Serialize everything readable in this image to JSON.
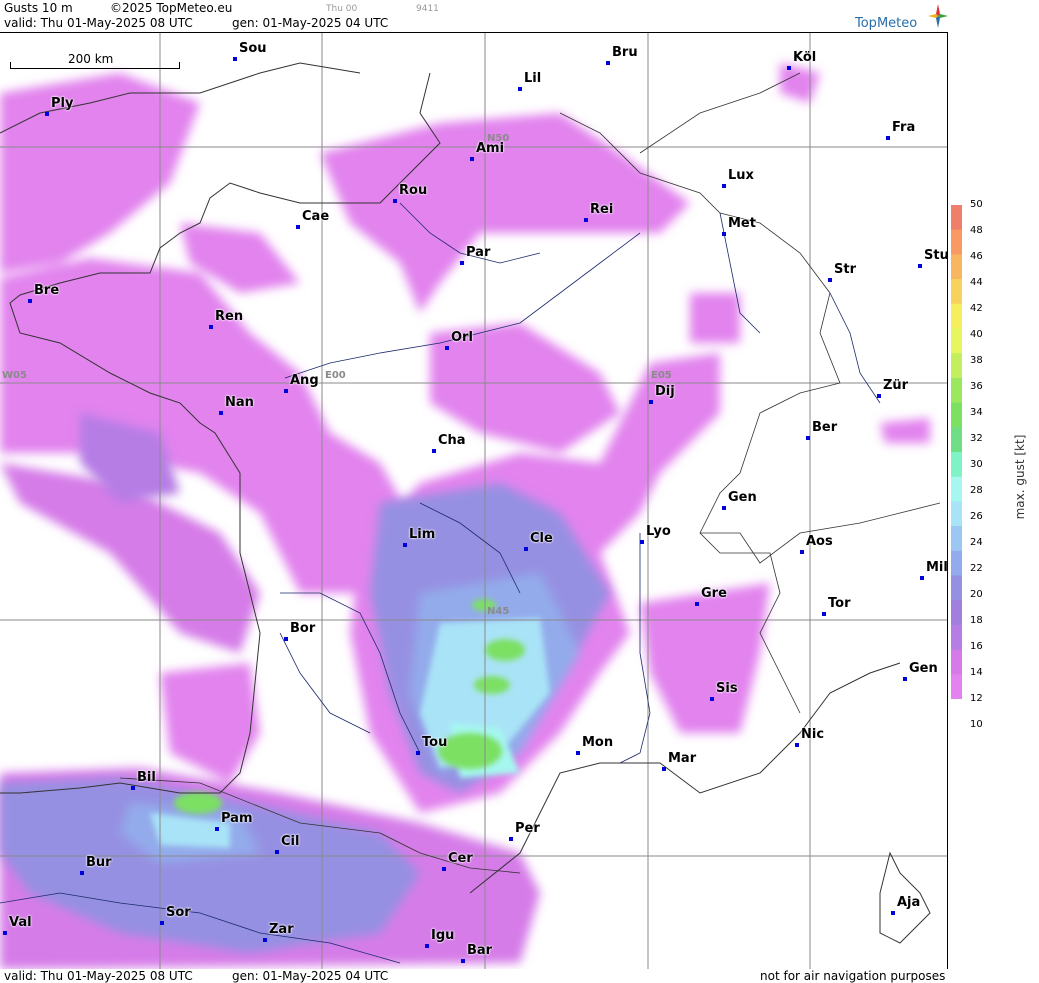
{
  "header": {
    "product": "Gusts 10 m",
    "copyright": "©2025 TopMeteo.eu",
    "run_small": "Thu 00",
    "code_small": "9411",
    "valid": "valid:  Thu  01-May-2025  08 UTC",
    "gen": "gen: 01-May-2025 04 UTC",
    "logo": "TopMeteo"
  },
  "footer": {
    "valid": "valid:  Thu  01-May-2025  08 UTC",
    "gen": "gen: 01-May-2025 04 UTC",
    "disclaimer": "not for air navigation purposes"
  },
  "scale_label": "200 km",
  "grid_labels": [
    "N50",
    "N45",
    "W05",
    "E00",
    "E05"
  ],
  "cities": [
    "Sou",
    "Bru",
    "Köl",
    "Ply",
    "Lil",
    "Fra",
    "Ami",
    "Lux",
    "Rou",
    "Rei",
    "Cae",
    "Met",
    "Par",
    "Stu",
    "Bre",
    "Str",
    "Ren",
    "Orl",
    "Ang",
    "Dij",
    "Zür",
    "Nan",
    "Ber",
    "Cha",
    "Gen",
    "Lim",
    "Cle",
    "Lyo",
    "Aos",
    "Mil",
    "Gre",
    "Tor",
    "Bor",
    "Sis",
    "Gen",
    "Tou",
    "Mon",
    "Nic",
    "Mar",
    "Bil",
    "Pam",
    "Per",
    "Cil",
    "Cer",
    "Bur",
    "Aja",
    "Sor",
    "Val",
    "Zar",
    "Igu",
    "Bar"
  ],
  "legend": {
    "title": "max. gust [kt]",
    "ticks": [
      "50",
      "48",
      "46",
      "44",
      "42",
      "40",
      "38",
      "36",
      "34",
      "32",
      "30",
      "28",
      "26",
      "24",
      "22",
      "20",
      "18",
      "16",
      "14",
      "12",
      "10"
    ],
    "colors": [
      "#ef7f6a",
      "#f79a64",
      "#f7b660",
      "#f7d35e",
      "#f7ee5e",
      "#e5f65e",
      "#c3ef5e",
      "#9be85f",
      "#7ce063",
      "#6fde84",
      "#7ff2c6",
      "#a6f7f0",
      "#a9e3f7",
      "#9cc7f2",
      "#93abeb",
      "#9690e2",
      "#a17fdd",
      "#b67de5",
      "#d57be8",
      "#e283ee"
    ]
  }
}
